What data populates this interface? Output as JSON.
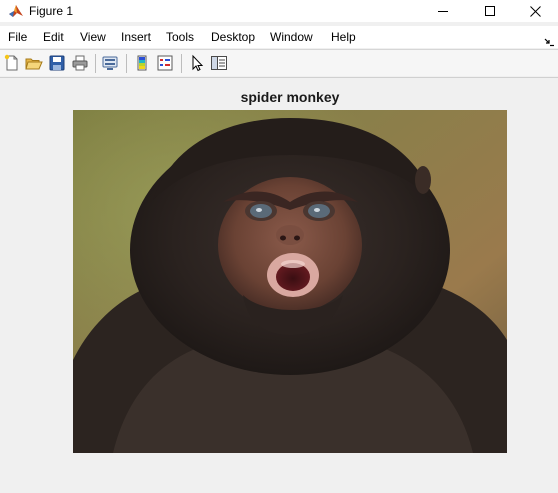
{
  "window": {
    "title": "Figure 1"
  },
  "menu": {
    "items": [
      {
        "label": "File"
      },
      {
        "label": "Edit"
      },
      {
        "label": "View"
      },
      {
        "label": "Insert"
      },
      {
        "label": "Tools"
      },
      {
        "label": "Desktop"
      },
      {
        "label": "Window"
      },
      {
        "label": "Help"
      }
    ]
  },
  "toolbar": {
    "buttons": [
      {
        "icon": "new-figure-icon"
      },
      {
        "icon": "open-file-icon"
      },
      {
        "icon": "save-icon"
      },
      {
        "icon": "print-icon"
      },
      {
        "icon": "link-plot-icon"
      },
      {
        "icon": "insert-colorbar-icon"
      },
      {
        "icon": "insert-legend-icon"
      },
      {
        "icon": "edit-plot-icon"
      },
      {
        "icon": "property-inspector-icon"
      }
    ]
  },
  "figure": {
    "axes_title": "spider monkey",
    "image_subject": "spider monkey photo"
  },
  "colors": {
    "background": "#f0f0f0",
    "titlebar": "#ffffff",
    "menubar": "#ffffff",
    "toolbar": "#f6f6f6"
  }
}
